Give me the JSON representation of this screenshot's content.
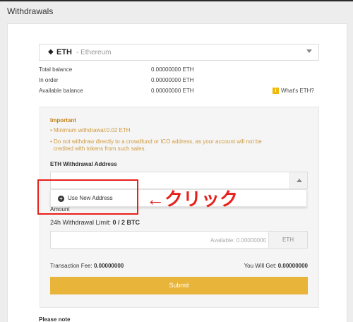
{
  "page_title": "Withdrawals",
  "coin": {
    "icon": "ethereum-icon",
    "symbol": "ETH",
    "name": "- Ethereum"
  },
  "balances": [
    {
      "label": "Total balance",
      "value": "0.00000000 ETH"
    },
    {
      "label": "In order",
      "value": "0.00000000 ETH"
    },
    {
      "label": "Available balance",
      "value": "0.00000000 ETH"
    }
  ],
  "whats_eth": "What's ETH?",
  "important": {
    "title": "Important",
    "lines": [
      "• Minimum withdrawal:0.02 ETH",
      "• Do not withdraw directly to a crowdfund or ICO address, as your account will not be",
      "  credited with tokens from such sales."
    ]
  },
  "address_label": "ETH Withdrawal Address",
  "dropdown_option": "Use New Address",
  "annotation": "←クリック",
  "amount_label": "Amount",
  "limit_prefix": "24h Withdrawal Limit: ",
  "limit_value": "0 / 2 BTC",
  "available_placeholder": "Available: 0.00000000",
  "unit": "ETH",
  "fee_label": "Transaction Fee: ",
  "fee_value": "0.00000000",
  "get_label": "You Will Get: ",
  "get_value": "0.00000000",
  "submit_label": "Submit",
  "note_title": "Please note",
  "colors": {
    "accent": "#e9b43a",
    "annotation": "#e8201b",
    "warning_text": "#d19a3f"
  }
}
